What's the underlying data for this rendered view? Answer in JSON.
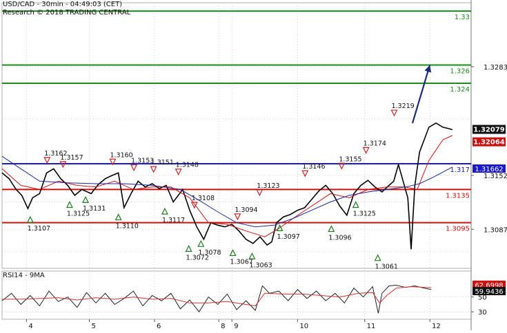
{
  "header": {
    "title": "USD/CAD - 30min - 04:49:03 (CET)",
    "credit": "Research © 2018 TRADING CENTRAL"
  },
  "colors": {
    "price": "#000000",
    "ma_fast": "#d01010",
    "ma_slow": "#1a2a9a",
    "resistance": "#1d8a1d",
    "support": "#cc1111",
    "pivot": "#1a1acc",
    "up_marker": "#1d7a1d",
    "down_marker": "#cc2222",
    "rsi": "#222222",
    "rsi_ma": "#cc3333",
    "arrow": "#1a2a7a"
  },
  "chart_data": [
    {
      "type": "line",
      "panel": "price",
      "ylim": [
        1.304,
        1.336
      ],
      "x_range": [
        0,
        100
      ],
      "day_ticks": [
        {
          "x": 5.2,
          "label": "4"
        },
        {
          "x": 18.6,
          "label": "5"
        },
        {
          "x": 32.5,
          "label": "6"
        },
        {
          "x": 46.2,
          "label": "8"
        },
        {
          "x": 49.0,
          "label": "9"
        },
        {
          "x": 63.0,
          "label": "10"
        },
        {
          "x": 77.3,
          "label": "11"
        },
        {
          "x": 91.2,
          "label": "12"
        }
      ],
      "y_ticks": [
        "1.3283",
        "1.3152",
        "1.3087"
      ],
      "levels": [
        {
          "kind": "resistance",
          "value": 1.335,
          "label": "1.33"
        },
        {
          "kind": "resistance",
          "value": 1.3285,
          "label": "1.326"
        },
        {
          "kind": "resistance",
          "value": 1.3263,
          "label": "1.324"
        },
        {
          "kind": "pivot",
          "value": 1.3166,
          "label": "1.317",
          "tag": "1.31662"
        },
        {
          "kind": "support",
          "value": 1.3135,
          "label": "1.3135"
        },
        {
          "kind": "support",
          "value": 1.3095,
          "label": "1.3095"
        }
      ],
      "last_price": {
        "value": 1.3207,
        "label": "1.32079"
      },
      "last_ma": {
        "value": 1.32,
        "label": "1.32064"
      },
      "series": [
        {
          "role": "price",
          "points": [
            [
              0,
              1.3155
            ],
            [
              1.5,
              1.3148
            ],
            [
              3,
              1.3135
            ],
            [
              4.2,
              1.3128
            ],
            [
              5.5,
              1.3112
            ],
            [
              6.5,
              1.3125
            ],
            [
              8,
              1.313
            ],
            [
              9.5,
              1.3155
            ],
            [
              11,
              1.316
            ],
            [
              12.5,
              1.3148
            ],
            [
              14,
              1.314
            ],
            [
              15.5,
              1.3128
            ],
            [
              17,
              1.3135
            ],
            [
              19,
              1.313
            ],
            [
              20.5,
              1.3141
            ],
            [
              22,
              1.3148
            ],
            [
              23.5,
              1.3152
            ],
            [
              24.8,
              1.3155
            ],
            [
              26,
              1.3113
            ],
            [
              27.5,
              1.313
            ],
            [
              29,
              1.3145
            ],
            [
              30.5,
              1.3138
            ],
            [
              32,
              1.3142
            ],
            [
              33.5,
              1.3136
            ],
            [
              35,
              1.314
            ],
            [
              36.5,
              1.312
            ],
            [
              38.5,
              1.3135
            ],
            [
              40,
              1.311
            ],
            [
              41.5,
              1.309
            ],
            [
              43,
              1.3075
            ],
            [
              44.5,
              1.3095
            ],
            [
              46,
              1.3092
            ],
            [
              47.5,
              1.309
            ],
            [
              49,
              1.3093
            ],
            [
              50.5,
              1.3085
            ],
            [
              52,
              1.3075
            ],
            [
              53.5,
              1.307
            ],
            [
              55,
              1.3078
            ],
            [
              56.5,
              1.3068
            ],
            [
              57.5,
              1.3072
            ],
            [
              58.5,
              1.3095
            ],
            [
              60,
              1.3102
            ],
            [
              61.5,
              1.3105
            ],
            [
              63,
              1.311
            ],
            [
              64.5,
              1.3113
            ],
            [
              66,
              1.3123
            ],
            [
              67.5,
              1.3133
            ],
            [
              69,
              1.314
            ],
            [
              70.5,
              1.313
            ],
            [
              72,
              1.3115
            ],
            [
              73.5,
              1.3104
            ],
            [
              75,
              1.313
            ],
            [
              76.5,
              1.314
            ],
            [
              78,
              1.3146
            ],
            [
              79.5,
              1.3138
            ],
            [
              81,
              1.3132
            ],
            [
              82.5,
              1.314
            ],
            [
              83.5,
              1.3145
            ],
            [
              84.5,
              1.3165
            ],
            [
              85.5,
              1.3145
            ],
            [
              86.5,
              1.3125
            ],
            [
              87.2,
              1.3063
            ],
            [
              88,
              1.314
            ],
            [
              89,
              1.318
            ],
            [
              90,
              1.3195
            ],
            [
              91,
              1.321
            ],
            [
              92.5,
              1.3215
            ],
            [
              94,
              1.321
            ],
            [
              95.5,
              1.3208
            ],
            [
              96,
              1.3207
            ]
          ]
        },
        {
          "role": "ma_fast",
          "points": [
            [
              0,
              1.316
            ],
            [
              4,
              1.314
            ],
            [
              8,
              1.3135
            ],
            [
              12,
              1.3145
            ],
            [
              16,
              1.314
            ],
            [
              20,
              1.3138
            ],
            [
              24,
              1.3145
            ],
            [
              28,
              1.3135
            ],
            [
              32,
              1.3138
            ],
            [
              36,
              1.3138
            ],
            [
              40,
              1.3125
            ],
            [
              44,
              1.3095
            ],
            [
              48,
              1.3093
            ],
            [
              52,
              1.3085
            ],
            [
              56,
              1.3078
            ],
            [
              59,
              1.3088
            ],
            [
              62,
              1.31
            ],
            [
              66,
              1.3115
            ],
            [
              70,
              1.313
            ],
            [
              74,
              1.3125
            ],
            [
              78,
              1.3135
            ],
            [
              82,
              1.3138
            ],
            [
              86,
              1.3138
            ],
            [
              88.5,
              1.3135
            ],
            [
              91,
              1.317
            ],
            [
              94,
              1.3195
            ],
            [
              96,
              1.32
            ]
          ]
        },
        {
          "role": "ma_slow",
          "points": [
            [
              0,
              1.3175
            ],
            [
              4,
              1.316
            ],
            [
              8,
              1.3145
            ],
            [
              14,
              1.3143
            ],
            [
              20,
              1.3142
            ],
            [
              26,
              1.3142
            ],
            [
              32,
              1.314
            ],
            [
              38,
              1.3135
            ],
            [
              42,
              1.3122
            ],
            [
              46,
              1.3108
            ],
            [
              50,
              1.3095
            ],
            [
              54,
              1.309
            ],
            [
              58,
              1.3092
            ],
            [
              62,
              1.31
            ],
            [
              66,
              1.311
            ],
            [
              70,
              1.312
            ],
            [
              74,
              1.3128
            ],
            [
              78,
              1.3132
            ],
            [
              82,
              1.3135
            ],
            [
              86,
              1.3138
            ],
            [
              89,
              1.3142
            ],
            [
              92,
              1.315
            ],
            [
              96,
              1.3162
            ]
          ]
        }
      ],
      "markers": [
        {
          "x": 6.0,
          "y": 1.3107,
          "dir": "up",
          "label": "1.3107"
        },
        {
          "x": 9.6,
          "y": 1.3162,
          "dir": "down",
          "label": "1.3162"
        },
        {
          "x": 13.0,
          "y": 1.3157,
          "dir": "down",
          "label": "1.3157"
        },
        {
          "x": 14.4,
          "y": 1.3125,
          "dir": "up",
          "label": "1.3125"
        },
        {
          "x": 17.8,
          "y": 1.3131,
          "dir": "up",
          "label": "1.3131"
        },
        {
          "x": 23.6,
          "y": 1.316,
          "dir": "down",
          "label": "1.3160"
        },
        {
          "x": 24.8,
          "y": 1.311,
          "dir": "up",
          "label": "1.3110"
        },
        {
          "x": 28.1,
          "y": 1.3153,
          "dir": "down",
          "label": "1.3153"
        },
        {
          "x": 32.3,
          "y": 1.3151,
          "dir": "down",
          "label": "1.3151"
        },
        {
          "x": 34.7,
          "y": 1.3117,
          "dir": "up",
          "label": "1.3117"
        },
        {
          "x": 37.6,
          "y": 1.3148,
          "dir": "down",
          "label": "1.3148"
        },
        {
          "x": 39.8,
          "y": 1.3072,
          "dir": "up",
          "label": "1.3072"
        },
        {
          "x": 41.0,
          "y": 1.3108,
          "dir": "down",
          "label": "1.3108"
        },
        {
          "x": 42.4,
          "y": 1.3078,
          "dir": "up",
          "label": "1.3078"
        },
        {
          "x": 49.2,
          "y": 1.3067,
          "dir": "up",
          "label": "1.3067"
        },
        {
          "x": 50.2,
          "y": 1.3094,
          "dir": "down",
          "label": "1.3094"
        },
        {
          "x": 53.3,
          "y": 1.3063,
          "dir": "up",
          "label": "1.3063"
        },
        {
          "x": 54.9,
          "y": 1.3123,
          "dir": "down",
          "label": "1.3123"
        },
        {
          "x": 59.2,
          "y": 1.3097,
          "dir": "up",
          "label": "1.3097"
        },
        {
          "x": 64.6,
          "y": 1.3146,
          "dir": "down",
          "label": "1.3146"
        },
        {
          "x": 70.2,
          "y": 1.3096,
          "dir": "up",
          "label": "1.3096"
        },
        {
          "x": 72.4,
          "y": 1.3155,
          "dir": "down",
          "label": "1.3155"
        },
        {
          "x": 75.4,
          "y": 1.3125,
          "dir": "up",
          "label": "1.3125"
        },
        {
          "x": 77.6,
          "y": 1.3174,
          "dir": "down",
          "label": "1.3174"
        },
        {
          "x": 80.1,
          "y": 1.3061,
          "dir": "up",
          "label": "1.3061"
        },
        {
          "x": 83.6,
          "y": 1.3219,
          "dir": "down",
          "label": "1.3219"
        }
      ],
      "arrow": {
        "from": [
          87.5,
          1.3215
        ],
        "to": [
          91.2,
          1.3285
        ]
      }
    },
    {
      "type": "line",
      "panel": "rsi",
      "title": "RSI14 - 9MA",
      "ylim": [
        20,
        85
      ],
      "y_ticks": [
        50,
        30
      ],
      "last_rsi": {
        "value": 60.0,
        "label": "59.9436"
      },
      "last_ma": {
        "value": 62.6,
        "label": "62.6998"
      },
      "series": [
        {
          "role": "rsi",
          "points": [
            [
              0,
              45
            ],
            [
              2,
              55
            ],
            [
              4,
              40
            ],
            [
              6,
              52
            ],
            [
              8,
              38
            ],
            [
              10,
              58
            ],
            [
              12,
              44
            ],
            [
              14,
              50
            ],
            [
              16,
              36
            ],
            [
              18,
              56
            ],
            [
              20,
              42
            ],
            [
              22,
              55
            ],
            [
              24,
              40
            ],
            [
              26,
              48
            ],
            [
              28,
              58
            ],
            [
              30,
              38
            ],
            [
              32,
              52
            ],
            [
              34,
              45
            ],
            [
              36,
              55
            ],
            [
              38,
              34
            ],
            [
              40,
              46
            ],
            [
              42,
              30
            ],
            [
              44,
              50
            ],
            [
              46,
              40
            ],
            [
              48,
              54
            ],
            [
              50,
              33
            ],
            [
              52,
              45
            ],
            [
              54,
              32
            ],
            [
              55.5,
              65
            ],
            [
              57,
              55
            ],
            [
              59,
              58
            ],
            [
              61,
              45
            ],
            [
              63,
              60
            ],
            [
              65,
              48
            ],
            [
              67,
              58
            ],
            [
              69,
              45
            ],
            [
              71,
              55
            ],
            [
              73,
              42
            ],
            [
              75,
              62
            ],
            [
              77,
              50
            ],
            [
              79,
              64
            ],
            [
              80.2,
              28
            ],
            [
              81,
              55
            ],
            [
              82.5,
              65
            ],
            [
              84,
              66
            ],
            [
              86,
              63
            ],
            [
              88,
              65
            ],
            [
              90,
              62
            ],
            [
              91.5,
              60
            ]
          ]
        },
        {
          "role": "rsi_ma",
          "points": [
            [
              0,
              47
            ],
            [
              4,
              47
            ],
            [
              8,
              48
            ],
            [
              12,
              49
            ],
            [
              16,
              46
            ],
            [
              20,
              49
            ],
            [
              24,
              47
            ],
            [
              28,
              50
            ],
            [
              32,
              47
            ],
            [
              36,
              48
            ],
            [
              40,
              42
            ],
            [
              44,
              42
            ],
            [
              48,
              44
            ],
            [
              52,
              40
            ],
            [
              54,
              38
            ],
            [
              56,
              55
            ],
            [
              60,
              54
            ],
            [
              64,
              54
            ],
            [
              68,
              52
            ],
            [
              72,
              50
            ],
            [
              76,
              55
            ],
            [
              79,
              56
            ],
            [
              80.5,
              42
            ],
            [
              82,
              52
            ],
            [
              84,
              62
            ],
            [
              87,
              64
            ],
            [
              91.5,
              62.6
            ]
          ]
        }
      ]
    }
  ]
}
